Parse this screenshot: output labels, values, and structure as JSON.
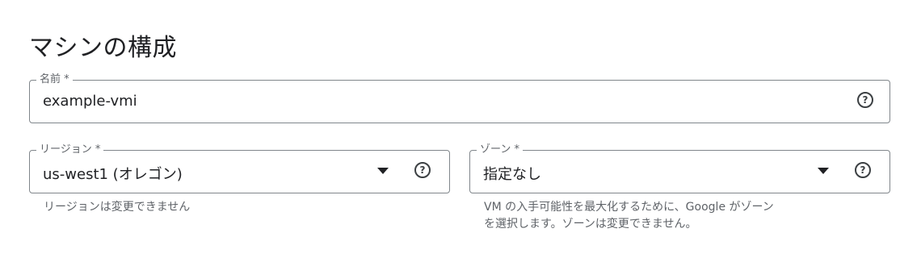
{
  "page": {
    "title": "マシンの構成"
  },
  "name_field": {
    "label": "名前 *",
    "value": "example-vmi",
    "help_icon": "help-circle-icon"
  },
  "region_field": {
    "label": "リージョン *",
    "value": "us-west1 (オレゴン)",
    "dropdown_icon": "arrow-drop-down-icon",
    "help_icon": "help-circle-icon",
    "hint": "リージョンは変更できません"
  },
  "zone_field": {
    "label": "ゾーン *",
    "value": "指定なし",
    "dropdown_icon": "arrow-drop-down-icon",
    "help_icon": "help-circle-icon",
    "hint_line1": "VM の入手可能性を最大化するために、Google がゾーン",
    "hint_line2": "を選択します。ゾーンは変更できません。"
  },
  "colors": {
    "text": "#202124",
    "secondary_text": "#5f6368",
    "outline": "#80868b"
  }
}
